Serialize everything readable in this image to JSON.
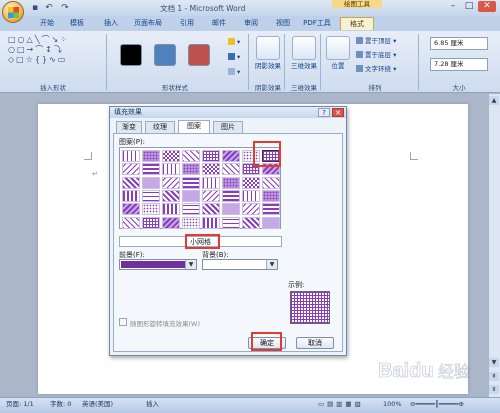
{
  "window": {
    "title": "文档 1 - Microsoft Word",
    "tools_tab_header": "绘图工具",
    "controls": [
      "–",
      "□",
      "✕"
    ]
  },
  "quick_access": {
    "icons": [
      "save-icon",
      "undo-icon",
      "redo-icon"
    ]
  },
  "tabs": [
    {
      "label": "开始"
    },
    {
      "label": "模板"
    },
    {
      "label": "插入"
    },
    {
      "label": "页面布局"
    },
    {
      "label": "引用"
    },
    {
      "label": "邮件"
    },
    {
      "label": "审阅"
    },
    {
      "label": "视图"
    },
    {
      "label": "PDF工具"
    },
    {
      "label": "格式"
    }
  ],
  "ribbon": {
    "groups": {
      "insert_shapes": "插入形状",
      "shape_styles": "形状样式",
      "shadow_effects": "阴影效果",
      "three_d_effects": "三维效果",
      "arrange": "排列",
      "size": "大小"
    },
    "shapes_glyphs": "□○△\\⌒↘\n○□→⌒↕⤵\n◇□☆{}∿▭",
    "style_swatch_colors": [
      "#000000",
      "#4f81bd",
      "#c0504d"
    ],
    "shadow_btn": "阴影效果",
    "threed_btn": "三维效果",
    "position_btn": "位置",
    "bring_front": "置于顶层",
    "send_back": "置于底层",
    "text_wrap": "文字环绕",
    "height_value": "6.85 厘米",
    "width_value": "7.28 厘米"
  },
  "dialog": {
    "title": "填充效果",
    "help": "?",
    "close": "✕",
    "tabs": [
      "渐变",
      "纹理",
      "图案",
      "图片"
    ],
    "active_tab": "图案",
    "pattern_label": "图案(P):",
    "selected_pattern_name": "小网格",
    "foreground_label": "前景(F):",
    "background_label": "背景(B):",
    "foreground_color": "#7030a0",
    "sample_label": "示例:",
    "rotate_label": "随图形旋转填充效果(W)",
    "ok": "确定",
    "cancel": "取消"
  },
  "status": {
    "page": "页面: 1/1",
    "words": "字数: 0",
    "language": "英语(美国)",
    "mode": "插入",
    "zoom": "100%"
  },
  "watermark": "Baidu 经验"
}
